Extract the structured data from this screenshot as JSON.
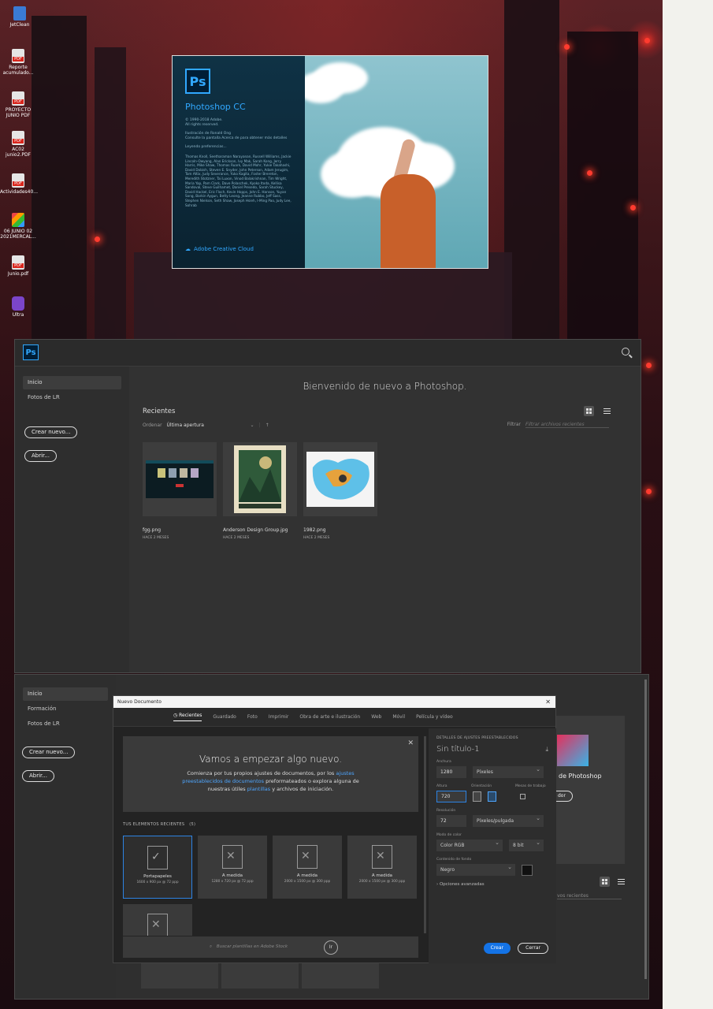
{
  "desktop_icons": [
    {
      "label": "JetClean",
      "icon": "jetclean-icon"
    },
    {
      "label": "Reporte acumulado...",
      "icon": "pdf-icon"
    },
    {
      "label": "PROYECTO JUNIO PDF",
      "icon": "pdf-icon"
    },
    {
      "label": "AC02 junio2.PDF",
      "icon": "pdf-icon"
    },
    {
      "label": "Actividades40...",
      "icon": "pdf-icon"
    },
    {
      "label": "06 JUNIO 02 2021MERCAL...",
      "icon": "office-icon"
    },
    {
      "label": "Junio.pdf",
      "icon": "pdf-icon"
    },
    {
      "label": "Ultra",
      "icon": "ultra-icon"
    }
  ],
  "splash": {
    "logo": "Ps",
    "title": "Photoshop CC",
    "copyright": "© 1990-2018 Adobe.",
    "rights": "All rights reserved.",
    "illustration": "Ilustración de Ronald Ong",
    "consult": "Consulte la pantalla Acerca de para obtener más detalles",
    "loading": "Leyendo preferencias...",
    "credits": "Thomas Knoll, Seetharaman Narayanan, Russell Williams, Jackie Lincoln-Owyang, Alan Erickson, Ivy Mak, Sarah Kong, Jerry Harris, Mike Shaw, Thomas Ruark, David Mohr, Yukie Takahashi, David Dobish, Steven E. Snyder, John Peterson, Adam Jerugim, Tom Attix, Judy Severance, Yuko Kagita, Foster Brereton, Meredith Stotzner, Tai Luxon, Vinod Balakrishnan, Tim Wright, Maria Yap, Pam Clark, Dave Polaschek, Kyoko Itoda, Kellisa Sandoval, Steve Guilhamet, Daniel Presedo, Sarah Stuckey, David Hackel, Eric Floch, Kevin Hopps, John E. Hanson, Yuyan Song, Barkin Aygun, Betty Leong, Jeanne Rubbo, Jeff Sass, Stephen Nielson, Seth Shaw, Joseph Hsieh, I-Ming Pao, Judy Lee, Sohrab",
    "cloud": "Adobe Creative Cloud"
  },
  "home": {
    "logo": "Ps",
    "nav": [
      "Inicio",
      "Fotos de LR"
    ],
    "create_label": "Crear nuevo...",
    "open_label": "Abrir...",
    "welcome": "Bienvenido de nuevo a Photoshop.",
    "recent_heading": "Recientes",
    "sort_label": "Ordenar",
    "sort_value": "Última apertura",
    "filter_label": "Filtrar",
    "filter_placeholder": "Filtrar archivos recientes",
    "files": [
      {
        "name": "fgg.png",
        "date": "HACE 2 MESES"
      },
      {
        "name": "Anderson Design Group.jpg",
        "date": "HACE 2 MESES"
      },
      {
        "name": "1982.png",
        "date": "HACE 2 MESES"
      }
    ]
  },
  "back_window": {
    "nav": [
      "Inicio",
      "Formación",
      "Fotos de LR"
    ],
    "create_label": "Crear nuevo...",
    "open_label": "Abrir...",
    "promo_title": "de Photoshop",
    "promo_button": "dor",
    "recent_files_hint": "vos recientes"
  },
  "modal": {
    "title": "Nuevo Documento",
    "tabs": [
      "Recientes",
      "Guardado",
      "Foto",
      "Imprimir",
      "Obra de arte e ilustración",
      "Web",
      "Móvil",
      "Película y vídeo"
    ],
    "hero_title": "Vamos a empezar algo nuevo.",
    "hero_text_1": "Comienza por tus propios ajustes de documentos, por los",
    "hero_link_1": "ajustes preestablecidos de documentos",
    "hero_text_2": "preformateados o explora alguna de nuestras útiles",
    "hero_link_2": "plantillas",
    "hero_text_3": "y archivos de iniciación.",
    "recent_heading": "TUS ELEMENTOS RECIENTES",
    "recent_count": "(5)",
    "cards": [
      {
        "name": "Portapapeles",
        "size": "1600 x 900 px @ 72 ppp"
      },
      {
        "name": "A medida",
        "size": "1280 x 720 px @ 72 ppp"
      },
      {
        "name": "A medida",
        "size": "2000 x 1500 px @ 300 ppp"
      },
      {
        "name": "A medida",
        "size": "2000 x 1500 px @ 300 ppp"
      },
      {
        "name": "",
        "size": ""
      }
    ],
    "search_placeholder": "Buscar plantillas en Adobe Stock",
    "search_go": "Ir",
    "details": {
      "heading": "DETALLES DE AJUSTES PREESTABLECIDOS",
      "doc_name": "Sin título-1",
      "width_label": "Anchura",
      "width": "1280",
      "width_unit": "Píxeles",
      "height_label": "Altura",
      "height": "720",
      "orientation_label": "Orientación",
      "artboards_label": "Mesas de trabajo",
      "resolution_label": "Resolución",
      "resolution": "72",
      "resolution_unit": "Píxeles/pulgada",
      "color_mode_label": "Modo de color",
      "color_mode": "Color RGB",
      "bit_depth": "8 bit",
      "background_label": "Contenido de fondo",
      "background": "Negro",
      "advanced": "Opciones avanzadas",
      "create_button": "Crear",
      "close_button": "Cerrar"
    }
  }
}
